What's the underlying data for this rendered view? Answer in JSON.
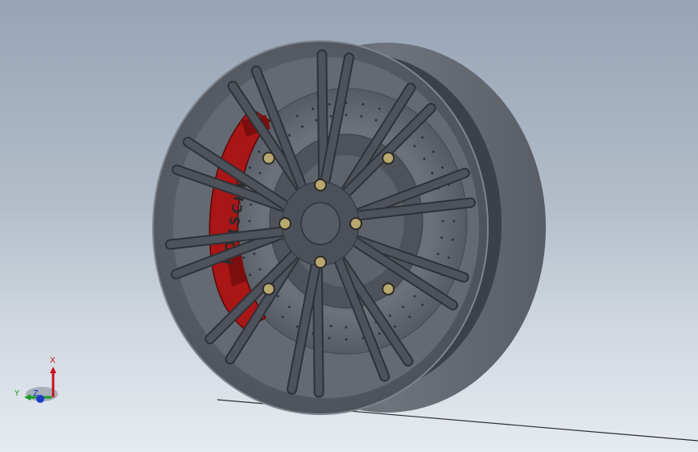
{
  "viewport": {
    "background_top": "#97a4b6",
    "background_bottom": "#e6ebf0"
  },
  "model": {
    "rim_color": "#5b6069",
    "spoke_color": "#4d525b",
    "caliper_color": "#a81616",
    "caliper_text": "PORSCHE",
    "lug_nut_color": "#b8a86e",
    "lug_nut_count": 8,
    "spoke_pair_count": 10
  },
  "triad": {
    "x_label": "X",
    "y_label": "Y",
    "z_label": "Z",
    "x_color": "#c8141e",
    "y_color": "#1f9a2a",
    "z_color": "#1c3cc8"
  }
}
